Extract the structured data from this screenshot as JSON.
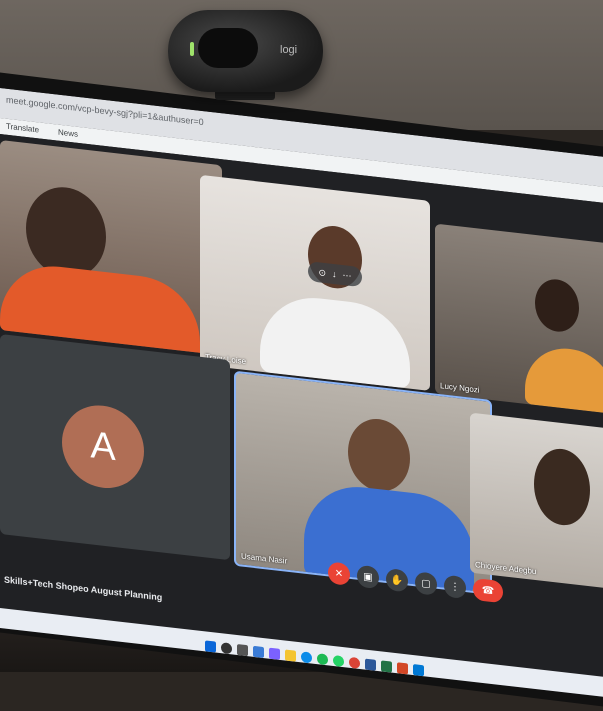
{
  "browser": {
    "url": "meet.google.com/vcp-bevy-sgj?pli=1&authuser=0",
    "bookmarks": [
      "Translate",
      "News"
    ]
  },
  "meet": {
    "meeting_title": "Skills+Tech Shopeo August Planning",
    "participants": [
      {
        "name": ""
      },
      {
        "name": "Tracy Loise"
      },
      {
        "name": "Lucy Ngozi"
      },
      {
        "name": "",
        "avatar_letter": "A",
        "avatar_color": "#b06e55"
      },
      {
        "name": "Usama Nasir"
      },
      {
        "name": "Chioyere Adegbu"
      }
    ],
    "controls": [
      "mic-off",
      "camera",
      "raise-hand",
      "present",
      "more",
      "end-call"
    ]
  },
  "webcam": {
    "brand": "logi"
  },
  "taskbar": {
    "icons": [
      "windows",
      "search",
      "task-view",
      "widgets",
      "chat",
      "files",
      "edge",
      "chrome",
      "spotify",
      "whatsapp",
      "word",
      "excel",
      "powerpoint",
      "outlook"
    ]
  }
}
